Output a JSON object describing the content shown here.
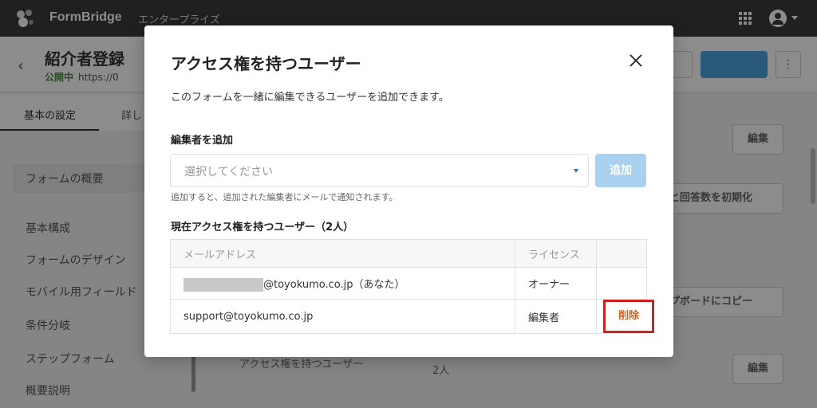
{
  "app": {
    "brand": "FormBridge",
    "edition": "エンタープライズ"
  },
  "header": {
    "form_title": "紹介者登録",
    "status": "公開中",
    "url": "https://0",
    "more_label": "⋮"
  },
  "tabs": [
    "基本の設定",
    "詳し"
  ],
  "sidebar": {
    "items": [
      "フォームの概要",
      "基本構成",
      "フォームのデザイン",
      "モバイル用フィールド",
      "条件分岐",
      "ステップフォーム",
      "概要説明"
    ]
  },
  "main": {
    "edit_label": "編集",
    "reset_label": "と回答数を初期化",
    "copy_label": "プボードにコピー",
    "access_row_label": "アクセス権を持つユーザー",
    "access_row_count": "2人"
  },
  "modal": {
    "title": "アクセス権を持つユーザー",
    "description": "このフォームを一緒に編集できるユーザーを追加できます。",
    "add_editor_label": "編集者を追加",
    "select_placeholder": "選択してください",
    "add_button": "追加",
    "helper": "追加すると、追加された編集者にメールで通知されます。",
    "current_users_label": "現在アクセス権を持つユーザー（2人）",
    "table": {
      "headers": [
        "メールアドレス",
        "ライセンス",
        ""
      ],
      "rows": [
        {
          "email": "@toyokumo.co.jp（あなた）",
          "license": "オーナー",
          "action": ""
        },
        {
          "email": "support@toyokumo.co.jp",
          "license": "編集者",
          "action": "削除"
        }
      ]
    }
  },
  "colors": {
    "topbar": "#3b3b3b",
    "primary": "#4fa3e0",
    "delete_highlight": "#d0231f"
  }
}
